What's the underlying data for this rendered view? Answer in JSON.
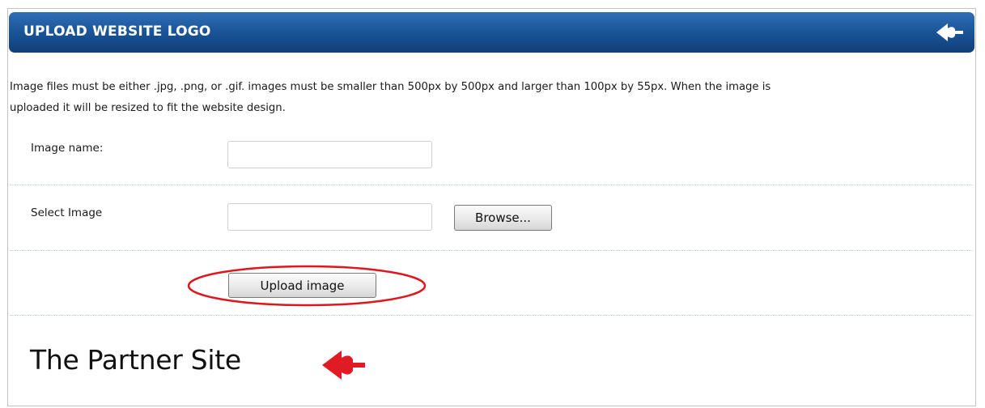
{
  "header": {
    "title": "UPLOAD WEBSITE LOGO",
    "icon": "spade-arrow-icon",
    "color": "#1a5496"
  },
  "description": {
    "line1": "Image files must be either .jpg, .png, or .gif. images must be smaller than 500px by 500px and larger than 100px by 55px. When the image is",
    "line2": "uploaded it will be resized to fit the website design."
  },
  "form": {
    "image_name": {
      "label": "Image name:",
      "value": "",
      "placeholder": ""
    },
    "select_image": {
      "label": "Select Image",
      "value": "",
      "placeholder": "",
      "browse_label": "Browse..."
    },
    "upload_label": "Upload image"
  },
  "highlight": {
    "target": "upload-image-button",
    "color": "#e0161d"
  },
  "footer_logo": {
    "text": "The Partner Site",
    "icon": "spade-arrow-icon",
    "icon_color": "#e01b24"
  }
}
